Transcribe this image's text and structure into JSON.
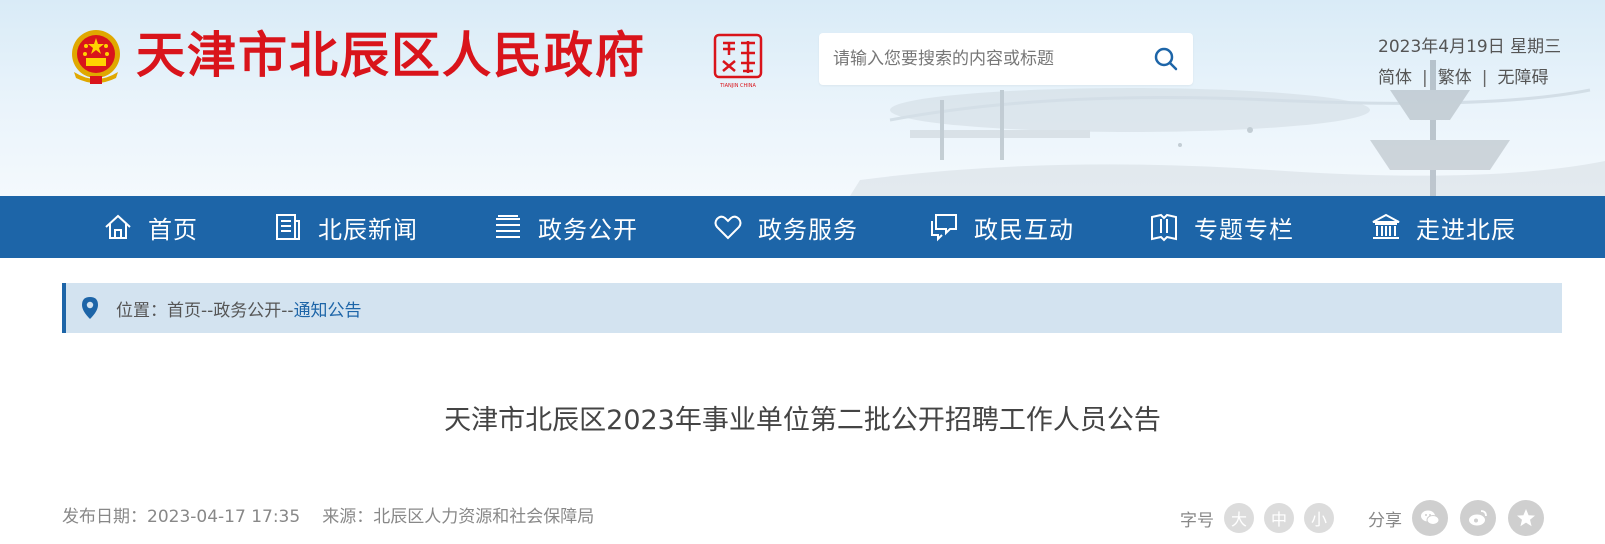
{
  "header": {
    "site_title": "天津市北辰区人民政府",
    "seal_text": "TIANJIN CHINA",
    "search": {
      "placeholder": "请输入您要搜索的内容或标题"
    },
    "date": "2023年4月19日 星期三",
    "lang_links": [
      "简体",
      "繁体",
      "无障碍"
    ],
    "lang_separator": "|"
  },
  "nav": {
    "items": [
      {
        "label": "首页",
        "icon": "home-icon"
      },
      {
        "label": "北辰新闻",
        "icon": "news-icon"
      },
      {
        "label": "政务公开",
        "icon": "layers-icon"
      },
      {
        "label": "政务服务",
        "icon": "heart-icon"
      },
      {
        "label": "政民互动",
        "icon": "chat-icon"
      },
      {
        "label": "专题专栏",
        "icon": "book-icon"
      },
      {
        "label": "走进北辰",
        "icon": "building-icon"
      }
    ]
  },
  "breadcrumb": {
    "prefix": "位置：",
    "items": [
      "首页",
      "政务公开",
      "通知公告"
    ],
    "separator": "--"
  },
  "article": {
    "title": "天津市北辰区2023年事业单位第二批公开招聘工作人员公告",
    "publish_label": "发布日期：",
    "publish_date": "2023-04-17 17:35",
    "source_label": "来源：",
    "source": "北辰区人力资源和社会保障局"
  },
  "tools": {
    "font_label": "字号",
    "font_sizes": [
      "大",
      "中",
      "小"
    ],
    "share_label": "分享",
    "share_targets": [
      "wechat-icon",
      "weibo-icon",
      "qzone-icon"
    ]
  },
  "colors": {
    "brand_red": "#d9141b",
    "nav_blue": "#1d65a8",
    "breadcrumb_bg": "#d3e3f0"
  }
}
